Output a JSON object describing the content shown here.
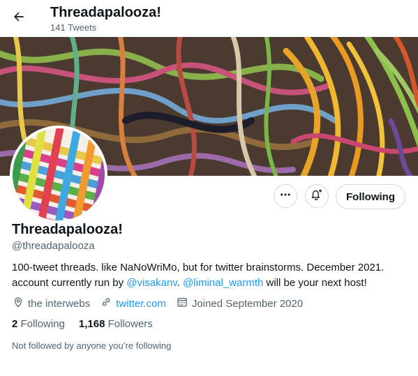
{
  "header": {
    "title": "Threadapalooza!",
    "tweet_count": "141 Tweets"
  },
  "profile": {
    "name": "Threadapalooza!",
    "handle": "@threadapalooza",
    "bio_line1": "100-tweet threads. like NaNoWriMo, but for twitter brainstorms. December 2021.",
    "bio_line2_pre": "account currently run by ",
    "bio_mention1": "@visakanv",
    "bio_line2_mid": ". ",
    "bio_mention2": "@liminal_warmth",
    "bio_line2_post": " will be your next host!",
    "location": "the interwebs",
    "website": "twitter.com",
    "joined": "Joined September 2020",
    "following_count": "2",
    "following_label": "Following",
    "followers_count": "1,168",
    "followers_label": "Followers",
    "not_followed_text": "Not followed by anyone you’re following"
  },
  "actions": {
    "following_button": "Following"
  },
  "colors": {
    "accent": "#1d9bf0",
    "secondary_text": "#536471",
    "primary_text": "#0f1419"
  },
  "icons": {
    "back": "arrow-left-icon",
    "more": "more-dots-icon",
    "notify": "bell-plus-icon",
    "location": "location-pin-icon",
    "link": "link-icon",
    "calendar": "calendar-icon"
  }
}
